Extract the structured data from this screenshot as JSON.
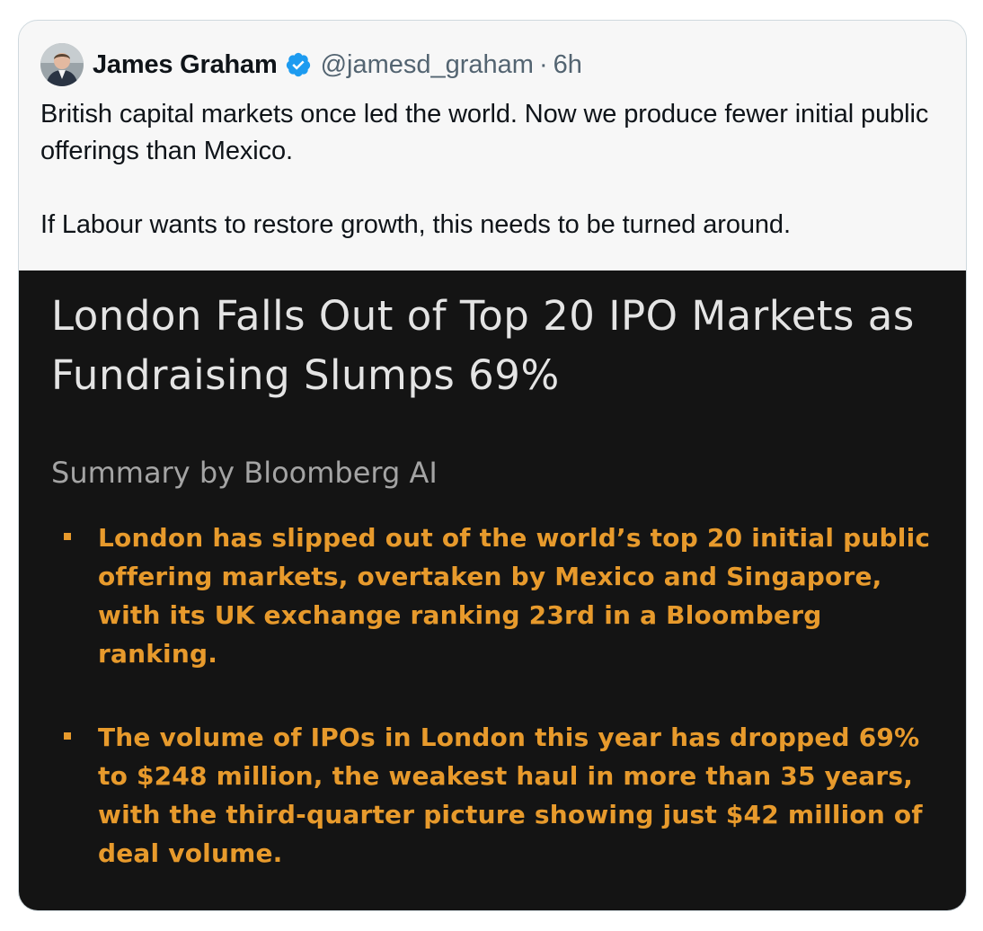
{
  "tweet": {
    "author": {
      "display_name": "James Graham",
      "handle": "@jamesd_graham",
      "separator": "·",
      "timestamp": "6h",
      "verified_icon": "verified-badge-icon",
      "verified_color": "#1d9bf0"
    },
    "text": {
      "paragraph_1": "British capital markets once led the world. Now we produce fewer initial public offerings than Mexico.",
      "paragraph_2": "If Labour wants to restore growth, this needs to be turned around."
    },
    "media": {
      "title": "London Falls Out of Top 20 IPO Markets as Fundraising Slumps 69%",
      "subtitle": "Summary by Bloomberg AI",
      "bullets": [
        "London has slipped out of the world’s top 20 initial public offering markets, overtaken by Mexico and Singapore, with its UK exchange ranking 23rd in a Bloomberg ranking.",
        "The volume of IPOs in London this year has dropped 69% to $248 million, the weakest haul in more than 35 years, with the third-quarter picture showing just $42 million of deal volume."
      ],
      "background_color": "#141414",
      "bullet_color": "#e79a2c"
    }
  }
}
